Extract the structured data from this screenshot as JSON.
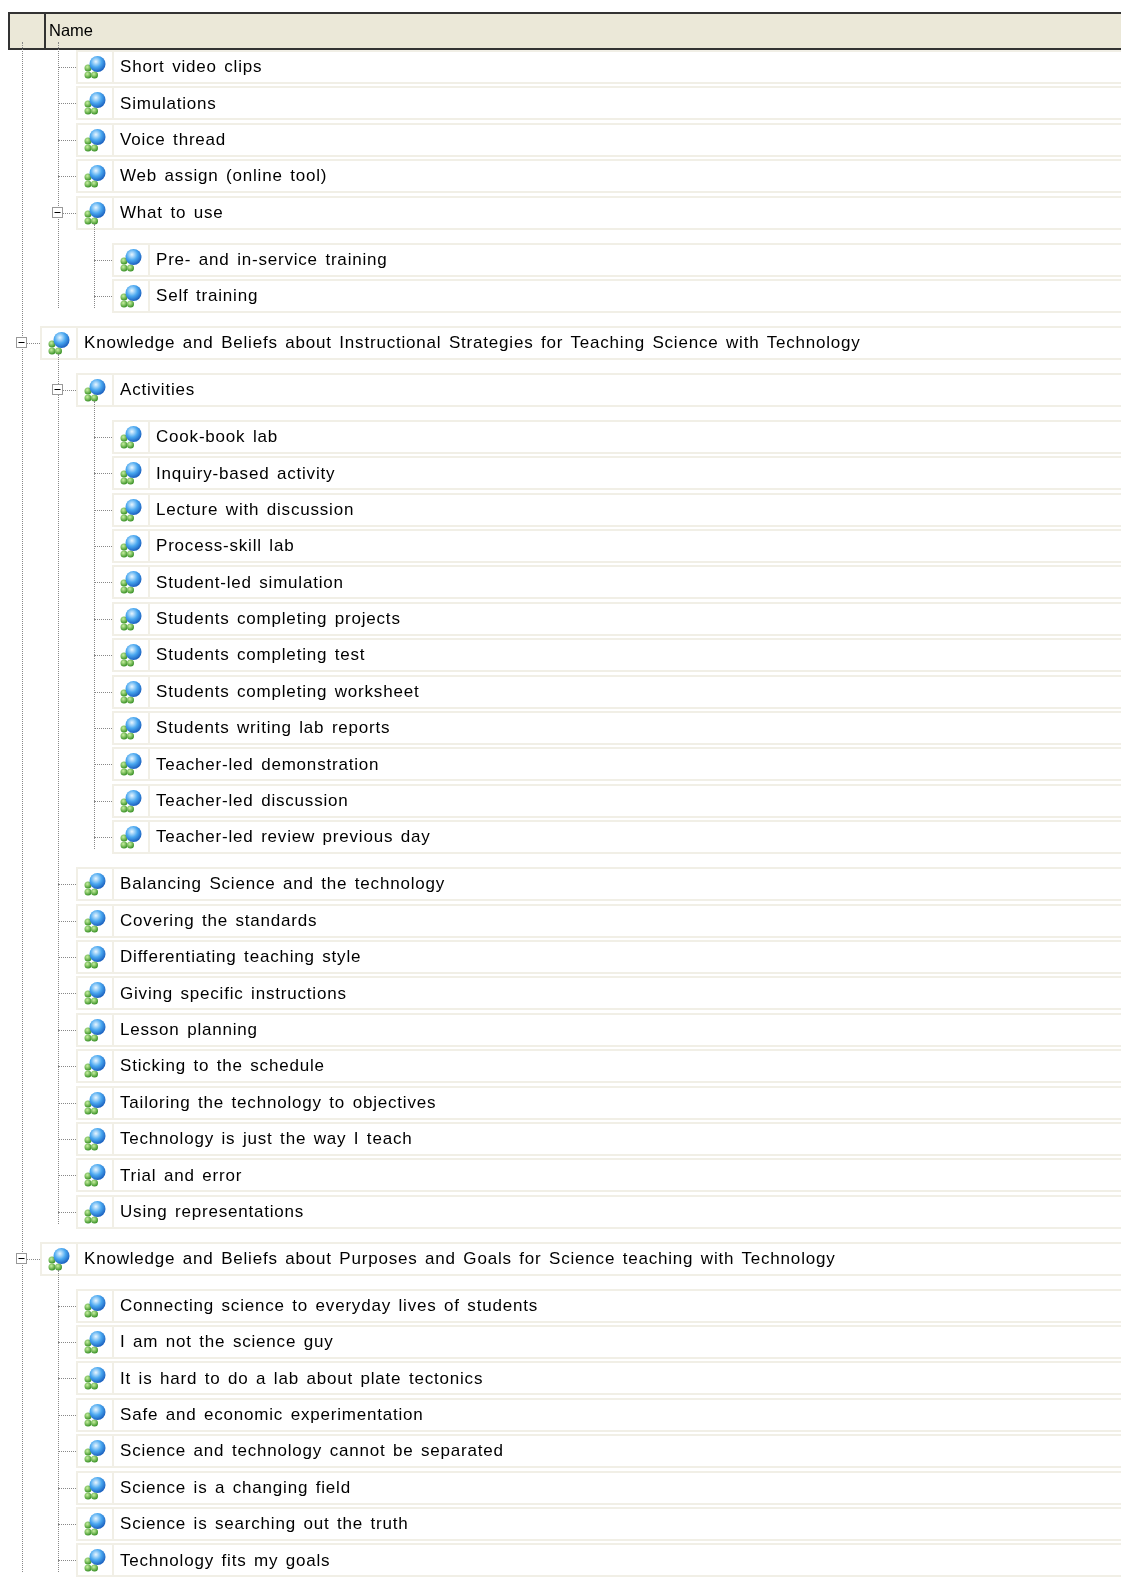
{
  "header": {
    "column": "Name"
  },
  "tree": [
    {
      "children": [
        {
          "label": "Short video clips"
        },
        {
          "label": "Simulations"
        },
        {
          "label": "Voice thread"
        },
        {
          "label": "Web assign (online tool)"
        },
        {
          "label": "What to use",
          "expanded": true,
          "children": [
            {
              "label": "Pre- and in-service training"
            },
            {
              "label": "Self training"
            }
          ]
        }
      ]
    },
    {
      "label": "Knowledge and Beliefs about Instructional Strategies for Teaching Science with Technology",
      "expanded": true,
      "children": [
        {
          "label": "Activities",
          "expanded": true,
          "children": [
            {
              "label": "Cook-book lab"
            },
            {
              "label": "Inquiry-based activity"
            },
            {
              "label": "Lecture with discussion"
            },
            {
              "label": "Process-skill lab"
            },
            {
              "label": "Student-led simulation"
            },
            {
              "label": "Students completing projects"
            },
            {
              "label": "Students completing test"
            },
            {
              "label": "Students completing worksheet"
            },
            {
              "label": "Students writing lab reports"
            },
            {
              "label": "Teacher-led demonstration"
            },
            {
              "label": "Teacher-led discussion"
            },
            {
              "label": "Teacher-led review previous day"
            }
          ]
        },
        {
          "label": "Balancing Science and the technology"
        },
        {
          "label": "Covering the standards"
        },
        {
          "label": "Differentiating teaching style"
        },
        {
          "label": "Giving specific instructions"
        },
        {
          "label": "Lesson planning"
        },
        {
          "label": "Sticking to the schedule"
        },
        {
          "label": "Tailoring the technology to objectives"
        },
        {
          "label": "Technology is just the way I teach"
        },
        {
          "label": "Trial and error"
        },
        {
          "label": "Using representations"
        }
      ]
    },
    {
      "label": "Knowledge and Beliefs about Purposes and Goals for Science teaching with Technology",
      "expanded": true,
      "children": [
        {
          "label": "Connecting science to everyday lives of students"
        },
        {
          "label": "I am not the science guy"
        },
        {
          "label": "It is hard to do a lab about plate tectonics"
        },
        {
          "label": "Safe and economic experimentation"
        },
        {
          "label": "Science and technology cannot be separated"
        },
        {
          "label": "Science is a changing field"
        },
        {
          "label": "Science is searching out the truth"
        },
        {
          "label": "Technology fits my goals"
        }
      ]
    }
  ]
}
